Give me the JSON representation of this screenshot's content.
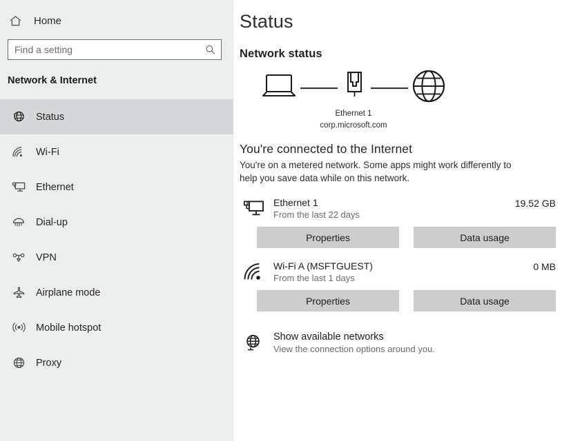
{
  "sidebar": {
    "home": {
      "label": "Home",
      "icon": "home-icon"
    },
    "search": {
      "value": "",
      "placeholder": "Find a setting",
      "icon": "search-icon"
    },
    "section_title": "Network & Internet",
    "items": [
      {
        "label": "Status",
        "icon": "status-globe-icon",
        "active": true
      },
      {
        "label": "Wi-Fi",
        "icon": "wifi-icon",
        "active": false
      },
      {
        "label": "Ethernet",
        "icon": "ethernet-icon",
        "active": false
      },
      {
        "label": "Dial-up",
        "icon": "dialup-icon",
        "active": false
      },
      {
        "label": "VPN",
        "icon": "vpn-icon",
        "active": false
      },
      {
        "label": "Airplane mode",
        "icon": "airplane-icon",
        "active": false
      },
      {
        "label": "Mobile hotspot",
        "icon": "mobile-hotspot-icon",
        "active": false
      },
      {
        "label": "Proxy",
        "icon": "proxy-globe-icon",
        "active": false
      }
    ]
  },
  "main": {
    "page_title": "Status",
    "section_title": "Network status",
    "diagram": {
      "device_icon": "laptop-icon",
      "adapter_icon": "ethernet-connector-icon",
      "internet_icon": "globe-icon",
      "adapter_name": "Ethernet 1",
      "domain": "corp.microsoft.com"
    },
    "connection_heading": "You're connected to the Internet",
    "connection_description": "You're on a metered network. Some apps might work differently to help you save data while on this network.",
    "adapters": [
      {
        "icon": "ethernet-monitor-icon",
        "name": "Ethernet 1",
        "meta": "From the last 22 days",
        "usage": "19.52 GB",
        "buttons": {
          "properties": "Properties",
          "data_usage": "Data usage"
        }
      },
      {
        "icon": "wifi-signal-icon",
        "name": "Wi-Fi A (MSFTGUEST)",
        "meta": "From the last 1 days",
        "usage": "0 MB",
        "buttons": {
          "properties": "Properties",
          "data_usage": "Data usage"
        }
      }
    ],
    "show_networks": {
      "icon": "available-networks-globe-icon",
      "title": "Show available networks",
      "description": "View the connection options around you."
    }
  },
  "colors": {
    "sidebar_bg": "#eceded",
    "sidebar_active_bg": "#d6d7d8",
    "main_bg": "#ffffff",
    "button_bg": "#cdcdcd",
    "text_primary": "#1d1d1d",
    "text_secondary": "#6c6c6c"
  }
}
